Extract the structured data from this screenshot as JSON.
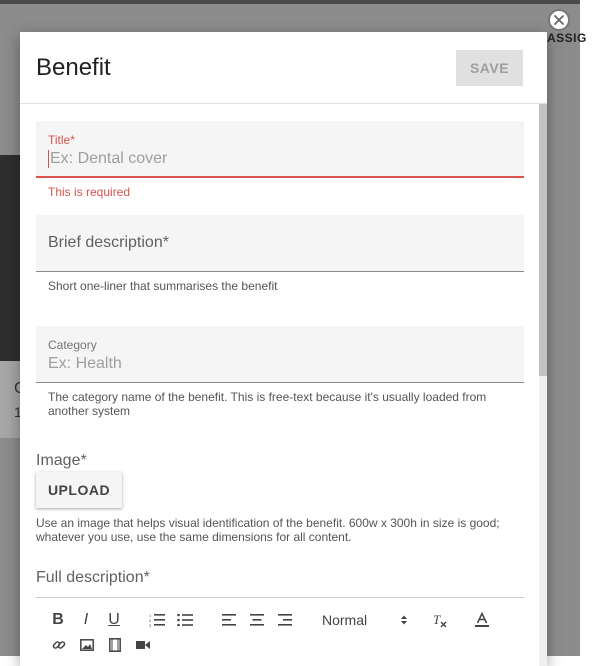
{
  "background": {
    "fragment_1": "C",
    "fragment_2": "1",
    "right_label": "ASSIG"
  },
  "dialog": {
    "title": "Benefit",
    "save_label": "SAVE"
  },
  "fields": {
    "title": {
      "label": "Title*",
      "placeholder": "Ex: Dental cover",
      "error": "This is required"
    },
    "brief_description": {
      "label": "Brief description*",
      "help": "Short one-liner that summarises the benefit"
    },
    "category": {
      "label": "Category",
      "placeholder": "Ex: Health",
      "help": "The category name of the benefit. This is free-text because it's usually loaded from another system"
    },
    "image": {
      "label": "Image*",
      "upload_label": "UPLOAD",
      "help": "Use an image that helps visual identification of the benefit. 600w x 300h in size is good; whatever you use, use the same dimensions for all content."
    },
    "full_description": {
      "label": "Full description*"
    }
  },
  "editor_toolbar": {
    "bold": "B",
    "italic": "I",
    "underline": "U",
    "heading_select": "Normal",
    "icons": [
      "bold-icon",
      "italic-icon",
      "underline-icon",
      "ordered-list-icon",
      "bullet-list-icon",
      "align-left-icon",
      "align-center-icon",
      "align-right-icon",
      "clear-format-icon",
      "font-color-icon",
      "link-icon",
      "image-icon",
      "video-icon",
      "camera-icon"
    ]
  },
  "colors": {
    "error": "#d9534f",
    "field_bg": "#f5f5f5",
    "save_bg": "#e0e0e0"
  }
}
